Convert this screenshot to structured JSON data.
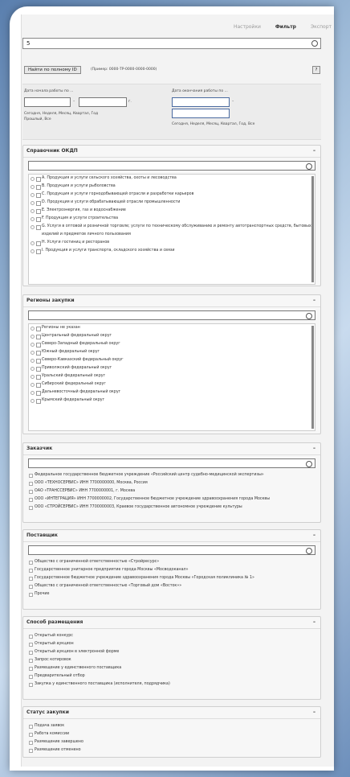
{
  "tabs": [
    "Настройки",
    "Фильтр",
    "Экспорт"
  ],
  "search": {
    "value": "5"
  },
  "toolbar": {
    "button_label": "Найти по полному ID",
    "hint": "(Пример: 0000-TP-0000-0000-0000)",
    "help": "?"
  },
  "filters": {
    "left_title": "Дата начала работы по ...",
    "left_dash": "–",
    "left_suffix": "г.",
    "left_links": [
      "Сегодня",
      "Неделя",
      "Месяц",
      "Квартал",
      "Год"
    ],
    "left_links2": [
      "Прошлый",
      "Все"
    ],
    "right_title": "Дата окончания работы по ...",
    "right_dash": "–",
    "right_links": [
      "Сегодня",
      "Неделя",
      "Месяц",
      "Квартал",
      "Год",
      "Все"
    ]
  },
  "sections": [
    {
      "title": "Справочник ОКДП",
      "items": [
        "А. Продукция и услуги сельского хозяйства, охоты и лесоводства",
        "В. Продукция и услуги рыболовства",
        "С. Продукция и услуги горнодобывающей отрасли и разработки карьеров",
        "D. Продукция и услуги обрабатывающей отрасли промышленности",
        "E. Электроэнергия, газ и водоснабжение",
        "F. Продукция и услуги строительства",
        "G. Услуги в оптовой и розничной торговле; услуги по техническому обслуживанию и ремонту автотранспортных средств, бытовых изделий и предметов личного пользования",
        "H. Услуги гостиниц и ресторанов",
        "I. Продукция и услуги транспорта, складского хозяйства и связи"
      ]
    },
    {
      "title": "Регионы закупки",
      "items": [
        "Регионы не указан",
        "Центральный федеральный округ",
        "Северо-Западный федеральный округ",
        "Южный федеральный округ",
        "Северо-Кавказский федеральный округ",
        "Приволжский федеральный округ",
        "Уральский федеральный округ",
        "Сибирский федеральный округ",
        "Дальневосточный федеральный округ",
        "Крымский федеральный округ"
      ]
    },
    {
      "title": "Заказчик",
      "items": [
        "Федеральное государственное бюджетное учреждение «Российский центр судебно-медицинской экспертизы»",
        "ООО «ТЕХНОСЕРВИС» ИНН 7700000000, Москва, Россия",
        "ОАО «ТРАНССЕРВИС» ИНН 7700000001, г. Москва",
        "ООО «ИНТЕГРАЦИЯ» ИНН 7700000002, Государственное бюджетное учреждение здравоохранения города Москвы",
        "ООО «СТРОЙСЕРВИС» ИНН 7700000003, Краевое государственное автономное учреждение культуры"
      ]
    },
    {
      "title": "Поставщик",
      "items": [
        "Общество с ограниченной ответственностью «Стройресурс»",
        "Государственное унитарное предприятие города Москвы «Мосводоканал»",
        "Государственное бюджетное учреждение здравоохранения города Москвы «Городская поликлиника № 1»",
        "Общество с ограниченной ответственностью «Торговый дом «Восток»»",
        "Прочие"
      ]
    },
    {
      "title": "Способ размещения",
      "items": [
        "Открытый конкурс",
        "Открытый аукцион",
        "Открытый аукцион в электронной форме",
        "Запрос котировок",
        "Размещение у единственного поставщика",
        "Предварительный отбор",
        "Закупка у единственного поставщика (исполнителя, подрядчика)"
      ]
    },
    {
      "title": "Статус закупки",
      "items": [
        "Подача заявок",
        "Работа комиссии",
        "Размещение завершено",
        "Размещение отменено"
      ]
    }
  ]
}
